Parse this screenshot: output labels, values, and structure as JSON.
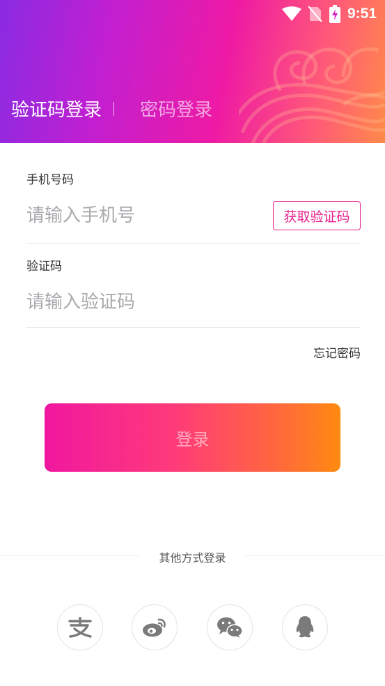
{
  "status_bar": {
    "time": "9:51"
  },
  "tabs": [
    {
      "label": "验证码登录",
      "active": true
    },
    {
      "label": "密码登录",
      "active": false
    }
  ],
  "form": {
    "phone": {
      "label": "手机号码",
      "placeholder": "请输入手机号",
      "value": ""
    },
    "get_code_button": "获取验证码",
    "code": {
      "label": "验证码",
      "placeholder": "请输入验证码",
      "value": ""
    },
    "forgot_password": "忘记密码"
  },
  "login_button": "登录",
  "other_login": {
    "title": "其他方式登录",
    "providers": [
      {
        "name": "alipay",
        "icon": "alipay-icon"
      },
      {
        "name": "weibo",
        "icon": "weibo-icon"
      },
      {
        "name": "wechat",
        "icon": "wechat-icon"
      },
      {
        "name": "qq",
        "icon": "qq-icon"
      }
    ]
  },
  "colors": {
    "accent": "#e5248e",
    "gradient_start": "#8a2be2",
    "gradient_end": "#ff8a10",
    "icon_gray": "#7a7a7a"
  }
}
